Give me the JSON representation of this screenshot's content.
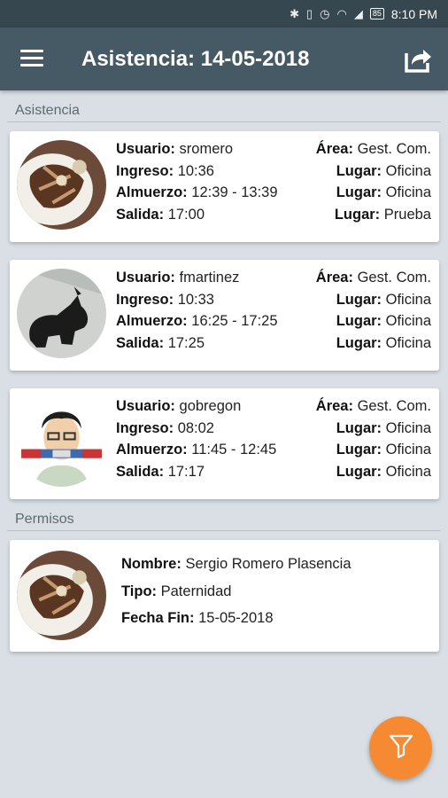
{
  "status_bar": {
    "battery": "85",
    "time": "8:10 PM",
    "icons": [
      "bluetooth-icon",
      "vibrate-icon",
      "alarm-icon",
      "wifi-icon",
      "signal-icon",
      "battery-icon"
    ]
  },
  "app_bar": {
    "title": "Asistencia: 14-05-2018",
    "menu_icon": "menu-icon",
    "share_icon": "share-icon"
  },
  "sections": {
    "attendance": "Asistencia",
    "permissions": "Permisos"
  },
  "attendance": [
    {
      "user_label": "Usuario:",
      "user": "sromero",
      "area_label": "Área:",
      "area": "Gest. Com.",
      "in_label": "Ingreso:",
      "in": "10:36",
      "in_place_label": "Lugar:",
      "in_place": "Oficina",
      "lunch_label": "Almuerzo:",
      "lunch": "12:39 - 13:39",
      "lunch_place_label": "Lugar:",
      "lunch_place": "Oficina",
      "out_label": "Salida:",
      "out": "17:00",
      "out_place_label": "Lugar:",
      "out_place": "Prueba"
    },
    {
      "user_label": "Usuario:",
      "user": "fmartinez",
      "area_label": "Área:",
      "area": "Gest. Com.",
      "in_label": "Ingreso:",
      "in": "10:33",
      "in_place_label": "Lugar:",
      "in_place": "Oficina",
      "lunch_label": "Almuerzo:",
      "lunch": "16:25 - 17:25",
      "lunch_place_label": "Lugar:",
      "lunch_place": "Oficina",
      "out_label": "Salida:",
      "out": "17:25",
      "out_place_label": "Lugar:",
      "out_place": "Oficina"
    },
    {
      "user_label": "Usuario:",
      "user": "gobregon",
      "area_label": "Área:",
      "area": "Gest. Com.",
      "in_label": "Ingreso:",
      "in": "08:02",
      "in_place_label": "Lugar:",
      "in_place": "Oficina",
      "lunch_label": "Almuerzo:",
      "lunch": "11:45 - 12:45",
      "lunch_place_label": "Lugar:",
      "lunch_place": "Oficina",
      "out_label": "Salida:",
      "out": "17:17",
      "out_place_label": "Lugar:",
      "out_place": "Oficina"
    }
  ],
  "permission": {
    "name_label": "Nombre:",
    "name": "Sergio Romero Plasencia",
    "type_label": "Tipo:",
    "type": "Paternidad",
    "end_label": "Fecha Fin:",
    "end": "15-05-2018"
  },
  "fab": {
    "icon": "filter-icon"
  },
  "colors": {
    "app_bar": "#455a64",
    "status_bar": "#37474f",
    "background": "#d9dfe4",
    "fab": "#f68a32"
  }
}
